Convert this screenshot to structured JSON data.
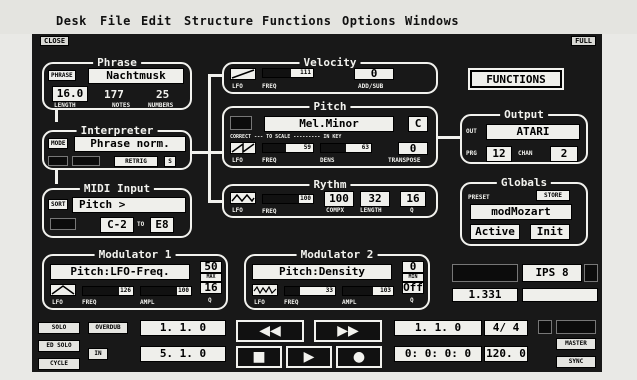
{
  "menu": [
    "Desk",
    "File",
    "Edit",
    "Structure",
    "Functions",
    "Options",
    "Windows"
  ],
  "window": {
    "close_label": "CLOSE",
    "full_label": "FULL"
  },
  "phrase": {
    "title": "Phrase",
    "type_label": "PHRASE",
    "name": "Nachtmusk",
    "length_value": "16.0",
    "notes_value": "177",
    "numbers_value": "25",
    "length_label": "LENGTH",
    "notes_label": "NOTES",
    "numbers_label": "NUMBERS"
  },
  "interpreter": {
    "title": "Interpreter",
    "mode_label": "MODE",
    "mode_value": "Phrase norm.",
    "retrig_label": "RETRIG",
    "s_label": "S"
  },
  "midi_input": {
    "title": "MIDI Input",
    "sort_label": "SORT",
    "sort_value": "Pitch >",
    "range_low": "C-2",
    "to_label": "TO",
    "range_high": "E8"
  },
  "velocity": {
    "title": "Velocity",
    "lfo_label": "LFO",
    "freq_label": "FREQ",
    "freq_value": "111",
    "freq_fill": 0.55,
    "add_sub_value": "0",
    "add_sub_label": "ADD/SUB"
  },
  "pitch": {
    "title": "Pitch",
    "scale_name": "Mel.Minor",
    "key_value": "C",
    "correct_label": "CORRECT --- TO SCALE --------- IN KEY",
    "lfo_label": "LFO",
    "freq_label": "FREQ",
    "freq_value": "59",
    "freq_fill": 0.45,
    "dens_label": "DENS",
    "dens_value": "63",
    "dens_fill": 0.5,
    "transpose_value": "0",
    "transpose_label": "TRANSPOSE"
  },
  "rhythm": {
    "title": "Rythm",
    "lfo_label": "LFO",
    "freq_label": "FREQ",
    "freq_value": "100",
    "freq_fill": 0.85,
    "compx_value": "100",
    "compx_label": "COMPX",
    "length_value": "32",
    "length_label": "LENGTH",
    "q_value": "16",
    "q_label": "Q"
  },
  "functions_button": "FUNCTIONS",
  "output": {
    "title": "Output",
    "out_label": "OUT",
    "out_value": "ATARI",
    "prg_label": "PRG",
    "prg_value": "12",
    "chan_label": "CHAN",
    "chan_value": "2"
  },
  "globals": {
    "title": "Globals",
    "preset_label": "PRESET",
    "store_label": "STORE",
    "preset_name": "modMozart",
    "active_label": "Active",
    "init_label": "Init"
  },
  "modulator1": {
    "title": "Modulator 1",
    "target": "Pitch:LFO-Freq.",
    "max_value": "50",
    "max_label": "MAX",
    "q_value": "16",
    "q_label": "Q",
    "lfo_label": "LFO",
    "freq_label": "FREQ",
    "freq_value": "126",
    "freq_fill": 0.8,
    "ampl_label": "AMPL",
    "ampl_value": "100",
    "ampl_fill": 0.85
  },
  "modulator2": {
    "title": "Modulator 2",
    "target": "Pitch:Density",
    "min_value": "0",
    "min_label": "MIN",
    "q_value": "Off",
    "q_label": "Q",
    "lfo_label": "LFO",
    "freq_label": "FREQ",
    "freq_value": "33",
    "freq_fill": 0.3,
    "ampl_label": "AMPL",
    "ampl_value": "103",
    "ampl_fill": 0.6
  },
  "side": {
    "ips_label": "IPS",
    "ips_value": "8",
    "tempo_value": "1.331"
  },
  "transport": {
    "solo": "SOLO",
    "ed_solo": "ED SOLO",
    "cycle": "CYCLE",
    "overdub": "OVERDUB",
    "in": "IN",
    "pos1": "1. 1. 0",
    "pos2": "5. 1. 0",
    "song_pos": "1. 1. 0",
    "time_sig": "4/ 4",
    "smpte": "0: 0: 0: 0",
    "tempo": "120. 0",
    "master": "MASTER",
    "sync": "SYNC",
    "rewind": "◀◀",
    "forward": "▶▶",
    "stop": "■",
    "play": "▶",
    "record": "●"
  }
}
